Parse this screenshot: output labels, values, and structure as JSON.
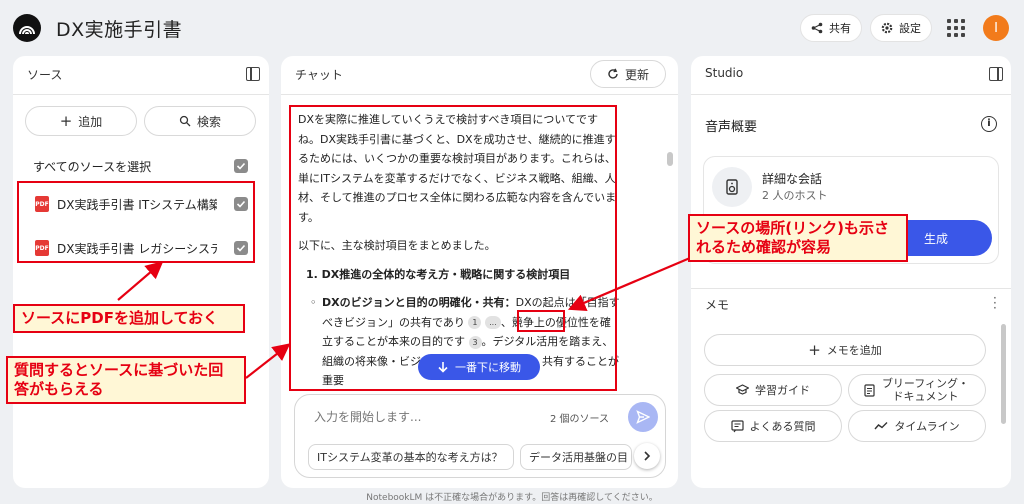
{
  "app": {
    "title": "DX実施手引書"
  },
  "header": {
    "share_label": "共有",
    "settings_label": "設定",
    "avatar_initial": "I"
  },
  "source_panel": {
    "title": "ソース",
    "add_label": "追加",
    "search_label": "検索",
    "select_all_label": "すべてのソースを選択",
    "items": [
      {
        "label": "DX実践手引書 ITシステム構築..."
      },
      {
        "label": "DX実践手引書 レガシーシステ..."
      }
    ]
  },
  "chat_panel": {
    "title": "チャット",
    "refresh_label": "更新",
    "intro": "DXを実際に推進していくうえで検討すべき項目についてですね。DX実践手引書に基づくと、DXを成功させ、継続的に推進するためには、いくつかの重要な検討項目があります。これらは、単にITシステムを変革するだけでなく、ビジネス戦略、組織、人材、そして推進のプロセス全体に関わる広範な内容を含んでいます。",
    "summary_line": "以下に、主な検討項目をまとめました。",
    "heading": "1. DX推進の全体的な考え方・戦略に関する検討項目",
    "bullet_title": "DXのビジョンと目的の明確化・共有：",
    "bullet_text_1": "DXの起点は「目指すべきビジョン」の共有であり",
    "cite_1": "1",
    "cite_more": "...",
    "bullet_text_2": "、競争上の優位性を確立することが本来の目的です",
    "cite_3": "3",
    "bullet_text_3": "。デジタル活用を踏まえ、組織の将来像・ビジョンを徹底的に議論し、共有することが重要",
    "scroll_bottom_label": "一番下に移動",
    "input_placeholder": "入力を開始します...",
    "source_count": "2 個のソース",
    "suggestions": [
      "ITシステム変革の基本的な考え方は？",
      "データ活用基盤の目"
    ]
  },
  "studio_panel": {
    "title": "Studio",
    "audio_overview_title": "音声概要",
    "card_title": "詳細な会話",
    "card_subtitle": "2 人のホスト",
    "generate_label": "生成",
    "memo_title": "メモ",
    "add_memo_label": "メモを追加",
    "buttons": [
      {
        "label": "学習ガイド"
      },
      {
        "label": "ブリーフィング・ドキュメント"
      },
      {
        "label": "よくある質問"
      },
      {
        "label": "タイムライン"
      }
    ]
  },
  "annotations": {
    "callout_pdf": "ソースにPDFを追加しておく",
    "callout_answer": "質問するとソースに基づいた回答がもらえる",
    "callout_link": "ソースの場所(リンク)も示されるため確認が容易"
  },
  "footer": {
    "disclaimer": "NotebookLM は不正確な場合があります。回答は再確認してください。"
  },
  "colors": {
    "accent": "#3a57e8",
    "annotation_red": "#e60012",
    "annotation_bg": "#fff7d6",
    "avatar": "#f27b1b"
  }
}
